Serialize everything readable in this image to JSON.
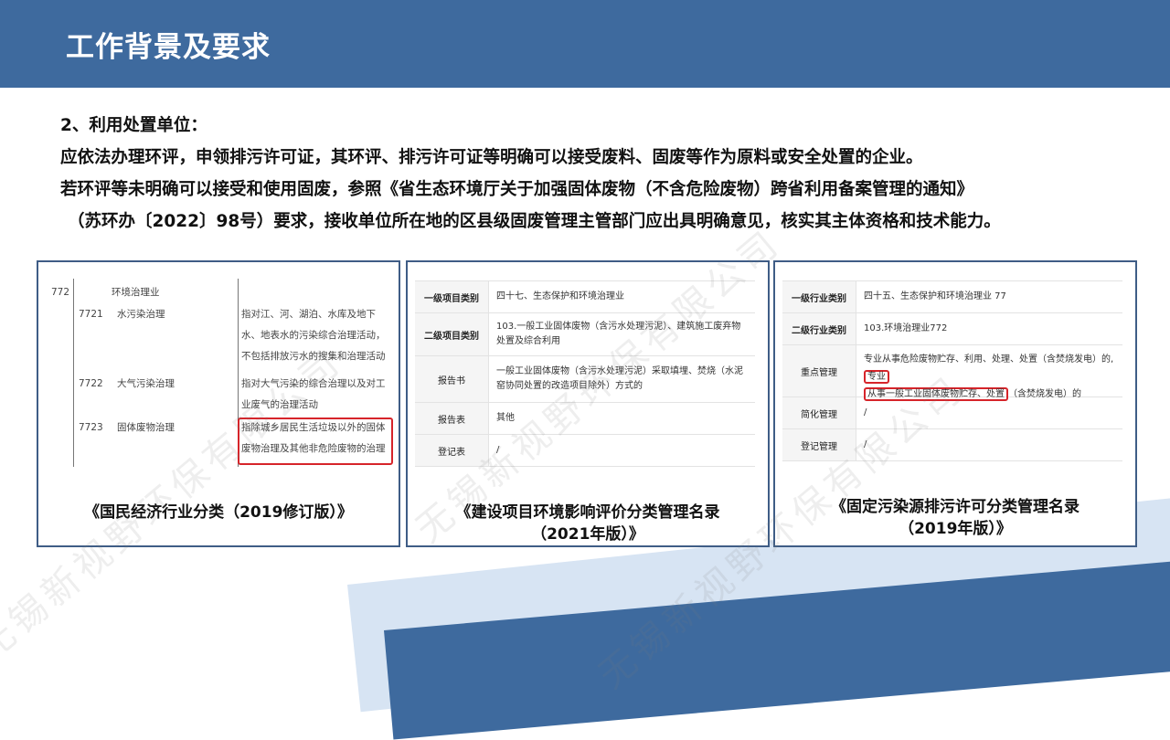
{
  "header": {
    "title": "工作背景及要求"
  },
  "intro": {
    "heading": "2、利用处置单位：",
    "line1": "应依法办理环评，申领排污许可证，其环评、排污许可证等明确可以接受废料、固废等作为原料或安全处置的企业。",
    "line2": "若环评等未明确可以接受和使用固废，参照《省生态环境厅关于加强固体废物（不含危险废物）跨省利用备案管理的通知》",
    "line3": "（苏环办〔2022〕98号）要求，接收单位所在地的区县级固废管理主管部门应出具明确意见，核实其主体资格和技术能力。"
  },
  "panel1": {
    "caption": "《国民经济行业分类（2019修订版）》",
    "code_772": "772",
    "label_772": "环境治理业",
    "rows": [
      {
        "code": "7721",
        "name": "水污染治理",
        "desc": "指对江、河、湖泊、水库及地下水、地表水的污染综合治理活动，不包括排放污水的搜集和治理活动"
      },
      {
        "code": "7722",
        "name": "大气污染治理",
        "desc": "指对大气污染的综合治理以及对工业废气的治理活动"
      },
      {
        "code": "7723",
        "name": "固体废物治理",
        "desc": "指除城乡居民生活垃圾以外的固体废物治理及其他非危险废物的治理"
      }
    ]
  },
  "panel2": {
    "caption_line1": "《建设项目环境影响评价分类管理名录",
    "caption_line2": "（2021年版）》",
    "rows": [
      {
        "key": "一级项目类别",
        "value": "四十七、生态保护和环境治理业"
      },
      {
        "key": "二级项目类别",
        "value": "103.一般工业固体废物（含污水处理污泥）、建筑施工废弃物处置及综合利用"
      },
      {
        "key": "报告书",
        "value": "一般工业固体废物（含污水处理污泥）采取填埋、焚烧（水泥窑协同处置的改造项目除外）方式的"
      },
      {
        "key": "报告表",
        "value": "其他"
      },
      {
        "key": "登记表",
        "value": "/"
      }
    ]
  },
  "panel3": {
    "caption_line1": "《固定污染源排污许可分类管理名录",
    "caption_line2": "（2019年版）》",
    "rows": [
      {
        "key": "一级行业类别",
        "value": "四十五、生态保护和环境治理业 77"
      },
      {
        "key": "二级行业类别",
        "value": "103.环境治理业772"
      },
      {
        "key": "重点管理",
        "value_a": "专业从事危险废物贮存、利用、处理、处置（含焚烧发电）的,",
        "value_b": "专业",
        "value_c": "从事一般工业固体废物贮存、处置",
        "value_d": "（含焚烧发电）的"
      },
      {
        "key": "简化管理",
        "value": "/"
      },
      {
        "key": "登记管理",
        "value": "/"
      }
    ]
  },
  "watermark": {
    "text": "无锡新视野环保有限公司"
  },
  "colors": {
    "header": "#3e6a9e",
    "panel_border": "#3f5d86",
    "highlight": "#d6242a"
  }
}
